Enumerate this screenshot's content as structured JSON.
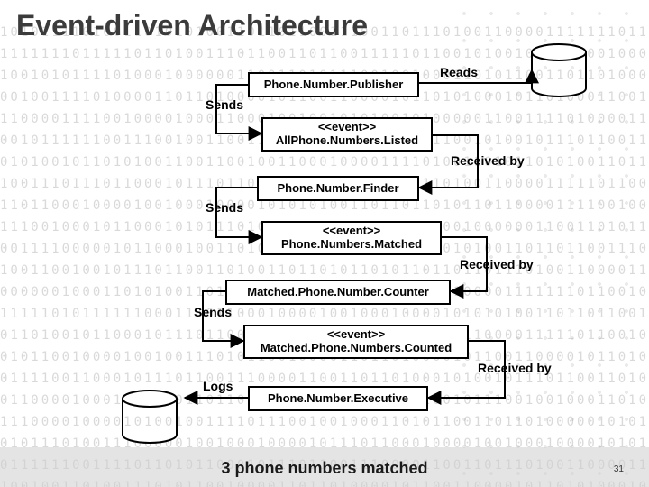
{
  "title": "Event-driven Architecture",
  "nodes": {
    "publisher": "Phone.Number.Publisher",
    "event1_st": "<<event>>",
    "event1": "AllPhone.Numbers.Listed",
    "finder": "Phone.Number.Finder",
    "event2_st": "<<event>>",
    "event2": "Phone.Numbers.Matched",
    "counter": "Matched.Phone.Number.Counter",
    "event3_st": "<<event>>",
    "event3": "Matched.Phone.Numbers.Counted",
    "executive": "Phone.Number.Executive"
  },
  "labels": {
    "reads": "Reads",
    "sends1": "Sends",
    "recv1": "Received by",
    "sends2": "Sends",
    "recv2": "Received by",
    "sends3": "Sends",
    "recv3": "Received by",
    "logs": "Logs"
  },
  "footer": "3 phone numbers matched",
  "page": "31"
}
